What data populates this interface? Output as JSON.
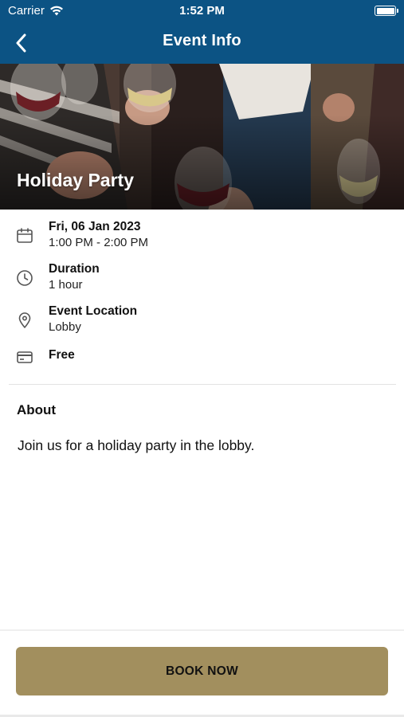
{
  "status_bar": {
    "carrier": "Carrier",
    "time": "1:52 PM",
    "icons": [
      "wifi-icon",
      "battery-icon"
    ]
  },
  "nav": {
    "title": "Event Info",
    "back_icon": "chevron-left-icon"
  },
  "colors": {
    "nav_background": "#0c5384",
    "button_background": "#a28f5e",
    "divider": "#e3e3e3"
  },
  "event": {
    "title": "Holiday Party",
    "date": "Fri, 06 Jan 2023",
    "time_range": "1:00 PM - 2:00 PM",
    "duration_label": "Duration",
    "duration_value": "1 hour",
    "location_label": "Event Location",
    "location_value": "Lobby",
    "price": "Free",
    "icons": [
      "calendar-icon",
      "clock-icon",
      "location-pin-icon",
      "credit-card-icon"
    ]
  },
  "about": {
    "title": "About",
    "text": "Join us for a holiday party in the lobby."
  },
  "actions": {
    "book_label": "BOOK NOW"
  }
}
